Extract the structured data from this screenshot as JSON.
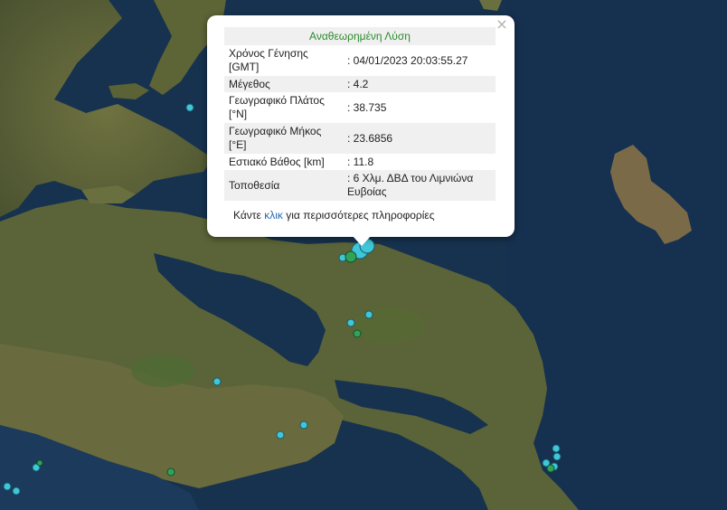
{
  "popup": {
    "title": "Αναθεωρημένη Λύση",
    "close_glyph": "×",
    "rows": [
      {
        "label": "Χρόνος Γένησης [GMT]",
        "value": ": 04/01/2023 20:03:55.27"
      },
      {
        "label": "Μέγεθος",
        "value": ": 4.2"
      },
      {
        "label": "Γεωγραφικό Πλάτος [°N]",
        "value": ": 38.735"
      },
      {
        "label": "Γεωγραφικό Μήκος [°E]",
        "value": ": 23.6856"
      },
      {
        "label": "Εστιακό Βάθος [km]",
        "value": ": 11.8"
      },
      {
        "label": "Τοποθεσία",
        "value": ": 6 Χλμ. ΔΒΔ του Λιμνιώνα Ευβοίας"
      }
    ],
    "more_prefix": "Κάντε",
    "more_link": "κλικ",
    "more_suffix": "για περισσότερες πληροφορίες"
  },
  "colors": {
    "sea": "#17324f",
    "land": "#5c6236",
    "marker_cyan": "#3fc7d9",
    "marker_green": "#2fa35a",
    "title_green": "#2b8a2b",
    "link_blue": "#2a6ab5"
  }
}
